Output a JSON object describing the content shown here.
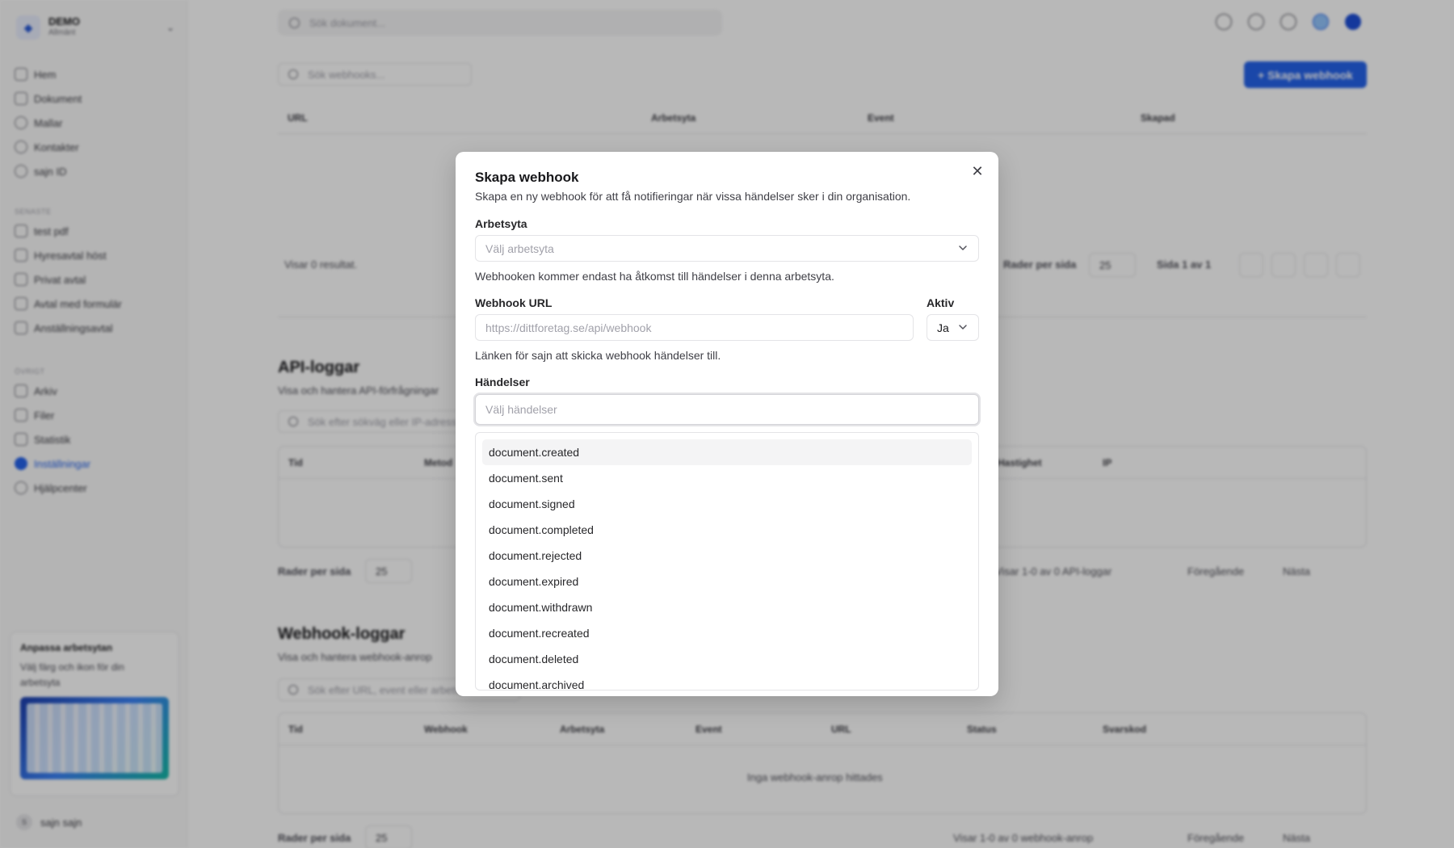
{
  "sidebar": {
    "workspace_name": "DEMO",
    "workspace_sub": "Allmänt",
    "nav_main": [
      "Hem",
      "Dokument",
      "Mallar",
      "Kontakter",
      "sajn ID"
    ],
    "recent_heading": "Senaste",
    "recent": [
      "test pdf",
      "Hyresavtal höst",
      "Privat avtal",
      "Avtal med formulär",
      "Anställningsavtal"
    ],
    "other_heading": "Övrigt",
    "nav_other": [
      "Arkiv",
      "Filer",
      "Statistik",
      "Inställningar",
      "Hjälpcenter"
    ],
    "active_item": "Inställningar",
    "promo_title": "Anpassa arbetsytan",
    "promo_desc": "Välj färg och ikon för din arbetsyta",
    "user_initial": "S",
    "user_name": "sajn sajn"
  },
  "topbar": {
    "search_placeholder": "Sök dokument..."
  },
  "webhooks": {
    "filter_placeholder": "Sök webhooks...",
    "create_button": "+ Skapa webhook",
    "columns": [
      "URL",
      "Arbetsyta",
      "Event",
      "Skapad"
    ],
    "results_text": "Visar 0 resultat.",
    "rows_per_page_label": "Rader per sida",
    "rows_per_page": "25",
    "page_text": "Sida 1 av 1"
  },
  "api_logs": {
    "title": "API-loggar",
    "subtitle": "Visa och hantera API-förfrågningar",
    "search_placeholder": "Sök efter sökväg eller IP-adress",
    "columns": [
      "Tid",
      "Metod",
      "Hastighet",
      "IP"
    ],
    "rows_per_page_label": "Rader per sida",
    "rows_per_page": "25",
    "range_text": "Visar 1-0 av 0 API-loggar",
    "prev": "Föregående",
    "next": "Nästa"
  },
  "webhook_logs": {
    "title": "Webhook-loggar",
    "subtitle": "Visa och hantera webhook-anrop",
    "search_placeholder": "Sök efter URL, event eller arbetsyta",
    "columns": [
      "Tid",
      "Webhook",
      "Arbetsyta",
      "Event",
      "URL",
      "Status",
      "Svarskod"
    ],
    "empty_text": "Inga webhook-anrop hittades",
    "rows_per_page_label": "Rader per sida",
    "rows_per_page": "25",
    "range_text": "Visar 1-0 av 0 webhook-anrop",
    "prev": "Föregående",
    "next": "Nästa"
  },
  "dialog": {
    "title": "Skapa webhook",
    "description": "Skapa en ny webhook för att få notifieringar när vissa händelser sker i din organisation.",
    "workspace_label": "Arbetsyta",
    "workspace_placeholder": "Välj arbetsyta",
    "workspace_help": "Webhooken kommer endast ha åtkomst till händelser i denna arbetsyta.",
    "url_label": "Webhook URL",
    "url_placeholder": "https://dittforetag.se/api/webhook",
    "url_help": "Länken för sajn att skicka webhook händelser till.",
    "active_label": "Aktiv",
    "active_value": "Ja",
    "events_label": "Händelser",
    "events_placeholder": "Välj händelser",
    "event_options": [
      "document.created",
      "document.sent",
      "document.signed",
      "document.completed",
      "document.rejected",
      "document.expired",
      "document.withdrawn",
      "document.recreated",
      "document.deleted",
      "document.archived"
    ],
    "highlighted_option": 0
  }
}
